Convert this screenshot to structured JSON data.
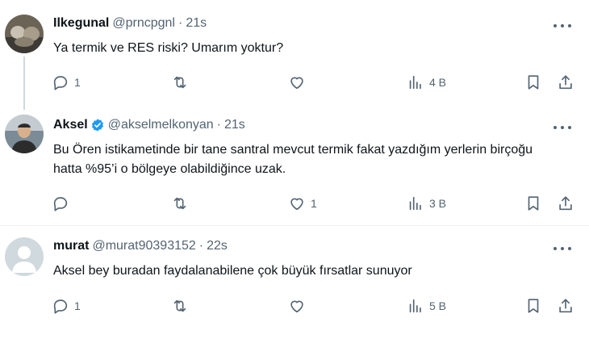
{
  "tweets": [
    {
      "name": "Ilkegunal",
      "handle": "@prncpgnl",
      "dot": "·",
      "time": "21s",
      "verified": false,
      "text": "Ya termik ve RES riski? Umarım yoktur?",
      "replies": "1",
      "retweets": "",
      "likes": "",
      "views": "4 B",
      "avatar_colors": [
        "#6b6355",
        "#c9c1b3",
        "#3d3a35"
      ]
    },
    {
      "name": "Aksel",
      "handle": "@akselmelkonyan",
      "dot": "·",
      "time": "21s",
      "verified": true,
      "text": "Bu Ören istikametinde bir tane santral mevcut termik fakat yazdığım yerlerin birçoğu hatta %95’i o bölgeye olabildiğince uzak.",
      "replies": "",
      "retweets": "",
      "likes": "1",
      "views": "3 B",
      "avatar_colors": [
        "#2c2c2c",
        "#d9b08c",
        "#7b8c97"
      ]
    },
    {
      "name": "murat",
      "handle": "@murat90393152",
      "dot": "·",
      "time": "22s",
      "verified": false,
      "text": "Aksel bey buradan faydalanabilene çok büyük fırsatlar sunuyor",
      "replies": "1",
      "retweets": "",
      "likes": "",
      "views": "5 B",
      "avatar_colors": [
        "#cfd9de",
        "#ffffff"
      ]
    }
  ],
  "colors": {
    "text": "#0f1419",
    "secondary": "#536471",
    "verified": "#1d9bf0",
    "divider": "#eff3f4",
    "thread_line": "#cfd9de"
  },
  "icons": [
    "reply-icon",
    "retweet-icon",
    "like-icon",
    "views-icon",
    "bookmark-icon",
    "share-icon",
    "more-icon",
    "verified-badge-icon"
  ]
}
